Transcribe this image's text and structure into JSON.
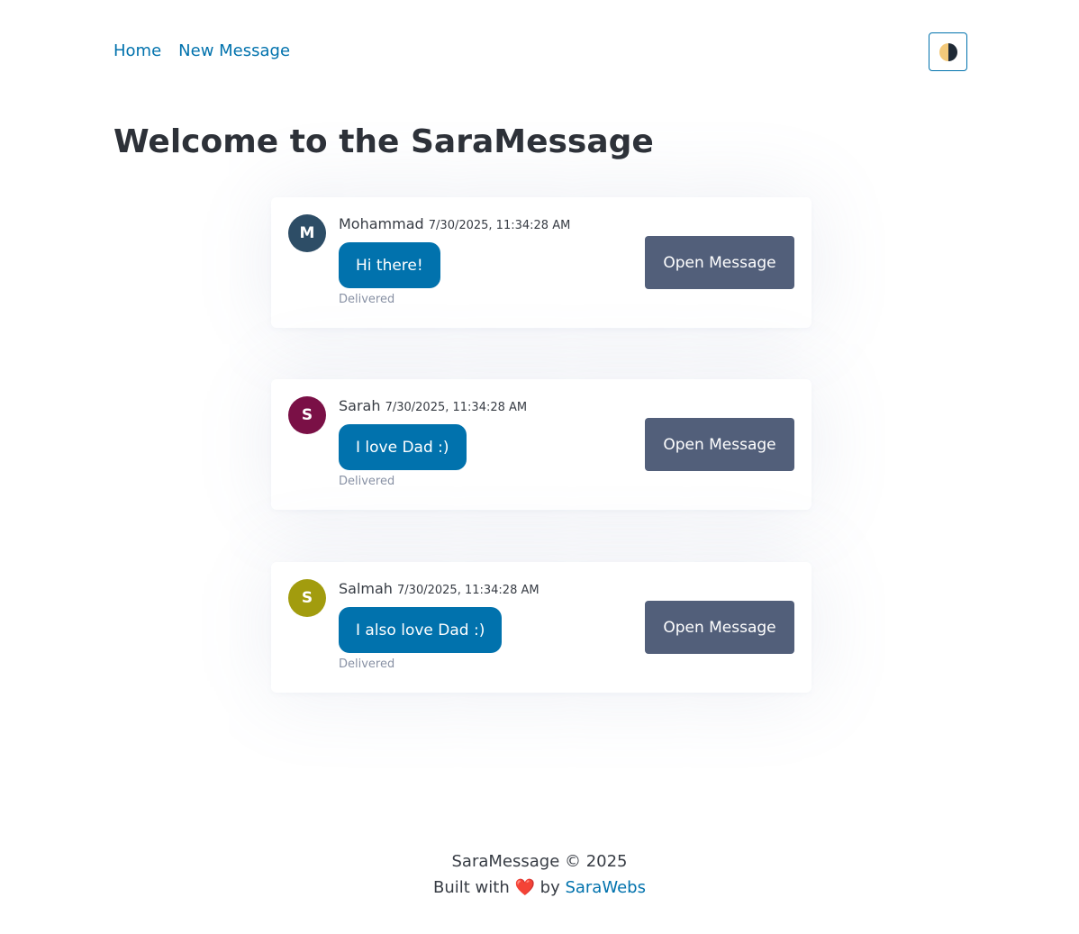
{
  "nav": {
    "home": "Home",
    "new_message": "New Message"
  },
  "theme_toggle": {
    "icon": "half-moon-icon",
    "colors": {
      "light": "#f3c97a",
      "dark": "#1f2a36"
    }
  },
  "title": "Welcome to the SaraMessage",
  "messages": [
    {
      "initial": "M",
      "avatar_color": "#2d4d66",
      "sender": "Mohammad",
      "timestamp": "7/30/2025, 11:34:28 AM",
      "text": "Hi there!",
      "status": "Delivered",
      "button": "Open Message"
    },
    {
      "initial": "S",
      "avatar_color": "#7a1046",
      "sender": "Sarah",
      "timestamp": "7/30/2025, 11:34:28 AM",
      "text": "I love Dad :)",
      "status": "Delivered",
      "button": "Open Message"
    },
    {
      "initial": "S",
      "avatar_color": "#a29c0e",
      "sender": "Salmah",
      "timestamp": "7/30/2025, 11:34:28 AM",
      "text": "I also love Dad :)",
      "status": "Delivered",
      "button": "Open Message"
    }
  ],
  "footer": {
    "copyright": "SaraMessage © 2025",
    "built_with": "Built with",
    "heart": "❤️",
    "by": "by",
    "link": "SaraWebs"
  },
  "colors": {
    "link": "#0172ad",
    "bubble": "#0172ad",
    "button": "#525f7a",
    "title": "#2d3138"
  }
}
